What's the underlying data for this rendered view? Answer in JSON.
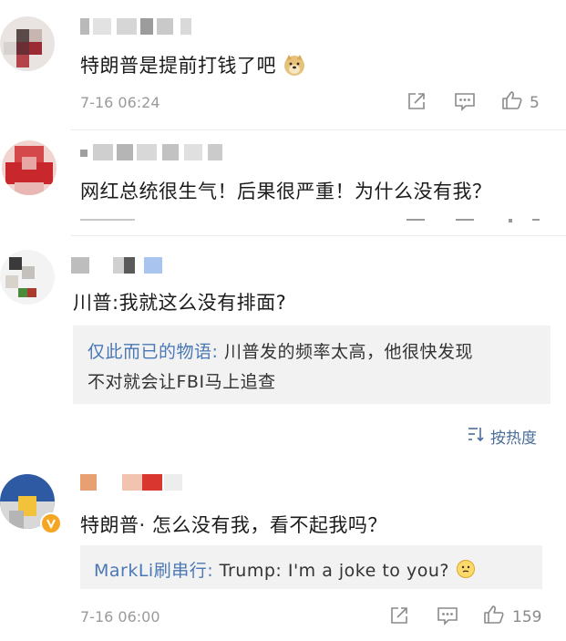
{
  "comments": [
    {
      "text": "特朗普是提前打钱了吧",
      "emoji": "doge-icon",
      "time": "7-16 06:24",
      "likes": "5"
    },
    {
      "text": "网红总统很生气！后果很严重！为什么没有我？"
    },
    {
      "text": "川普:我就这么没有排面?",
      "reply": {
        "user": "仅此而已的物语:",
        "line1": " 川普发的频率太高，他很快发现",
        "line2": "不对就会让FBI马上追查"
      }
    },
    {
      "text": "特朗普·  怎么没有我，看不起我吗？",
      "reply": {
        "user": "MarkLi刷串行:",
        "line1": " Trump: I'm a joke to you?",
        "emoji": "thinking-face-icon"
      },
      "time": "7-16 06:00",
      "likes": "159"
    }
  ],
  "sort": {
    "label": "按热度",
    "icon": "sort-icon"
  },
  "colors": {
    "link": "#4a78b5",
    "meta": "#9a9a9a",
    "reply_bg": "#f2f2f2",
    "badge": "#f5a623"
  }
}
